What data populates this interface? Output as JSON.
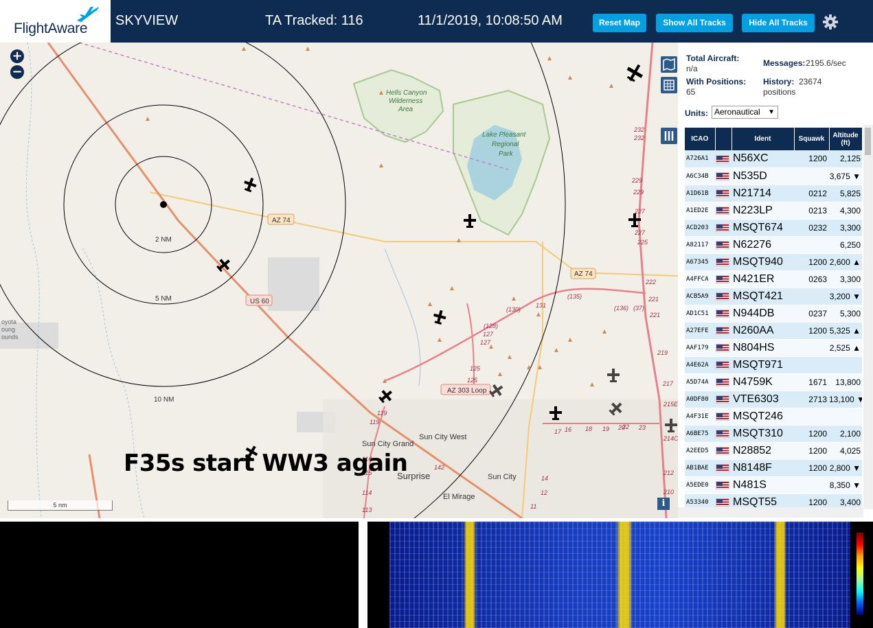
{
  "header": {
    "logo": "FlightAware",
    "app_name": "SKYVIEW",
    "tracked": "TA Tracked: 116",
    "datetime": "11/1/2019, 10:08:50 AM",
    "reset_map": "Reset Map",
    "show_all_tracks": "Show All Tracks",
    "hide_all_tracks": "Hide All Tracks"
  },
  "map": {
    "caption": "F35s start WW3 again",
    "scale": "5 nm",
    "zoom_in": "+",
    "zoom_out": "−",
    "info": "i",
    "rings": [
      "2 NM",
      "5 NM",
      "10 NM"
    ],
    "labels": {
      "hells_canyon": "Hells Canyon",
      "wilderness": "Wilderness",
      "area": "Area",
      "lake_pleasant": "Lake Pleasant",
      "regional": "Regional",
      "park": "Park",
      "az74_a": "AZ 74",
      "az74_b": "AZ 74",
      "us60": "US 60",
      "az303": "AZ 303 Loop",
      "sun_city_west": "Sun City West",
      "sun_city_grand": "Sun City Grand",
      "surprise": "Surprise",
      "sun_city": "Sun City",
      "el_mirage": "El Mirage",
      "coyote": "oyota",
      "coyote2": "oung",
      "coyote3": "ounds",
      "r131": "131",
      "r135": "(135)",
      "r130": "(130)",
      "r128": "(128)",
      "r127": "127",
      "r125": "125",
      "r136": "(136)",
      "r37": "(37)",
      "r119": "119",
      "r142": "142",
      "r17": "17",
      "r16": "16",
      "r18": "18",
      "r19": "19",
      "r20": "20",
      "r22": "22",
      "r23": "23",
      "r232": "232",
      "r229": "229",
      "r227": "227",
      "r225": "225",
      "r222": "222",
      "r221": "221",
      "r219": "219",
      "r217": "217",
      "r215": "215E",
      "r214": "214C",
      "r212": "212",
      "r210": "210",
      "r116": "116",
      "r115": "115",
      "r114": "114",
      "r113": "113",
      "r14": "14",
      "r12": "12",
      "r11": "11"
    }
  },
  "sidebar": {
    "total_aircraft_label": "Total Aircraft:",
    "total_aircraft_value": "n/a",
    "messages_label": "Messages:",
    "messages_value": "2195.6/sec",
    "with_positions_label": "With Positions:",
    "with_positions_value": "65",
    "history_label": "History:",
    "history_value": "23674",
    "history_unit": "positions",
    "units_label": "Units:",
    "units_value": "Aeronautical",
    "columns": [
      "ICAO",
      "",
      "Ident",
      "Squawk",
      "Altitude (ft)"
    ],
    "rows": [
      {
        "icao": "A726A1",
        "ident": "N56XC",
        "squawk": "1200",
        "alt": "2,125"
      },
      {
        "icao": "A6C34B",
        "ident": "N535D",
        "squawk": "",
        "alt": "3,675 ▼"
      },
      {
        "icao": "A1D61B",
        "ident": "N21714",
        "squawk": "0212",
        "alt": "5,825"
      },
      {
        "icao": "A1ED2E",
        "ident": "N223LP",
        "squawk": "0213",
        "alt": "4,300"
      },
      {
        "icao": "ACD203",
        "ident": "MSQT674",
        "squawk": "0232",
        "alt": "3,300"
      },
      {
        "icao": "A82117",
        "ident": "N62276",
        "squawk": "",
        "alt": "6,250"
      },
      {
        "icao": "A67345",
        "ident": "MSQT940",
        "squawk": "1200",
        "alt": "2,600 ▲"
      },
      {
        "icao": "A4FFCA",
        "ident": "N421ER",
        "squawk": "0263",
        "alt": "3,300"
      },
      {
        "icao": "ACB5A9",
        "ident": "MSQT421",
        "squawk": "",
        "alt": "3,200 ▼"
      },
      {
        "icao": "AD1C51",
        "ident": "N944DB",
        "squawk": "0237",
        "alt": "5,300"
      },
      {
        "icao": "A27EFE",
        "ident": "N260AA",
        "squawk": "1200",
        "alt": "5,325 ▲"
      },
      {
        "icao": "AAF179",
        "ident": "N804HS",
        "squawk": "",
        "alt": "2,525 ▲"
      },
      {
        "icao": "A4E62A",
        "ident": "MSQT971",
        "squawk": "",
        "alt": ""
      },
      {
        "icao": "A5D74A",
        "ident": "N4759K",
        "squawk": "1671",
        "alt": "13,800"
      },
      {
        "icao": "A0DF80",
        "ident": "VTE6303",
        "squawk": "2713",
        "alt": "13,100 ▼"
      },
      {
        "icao": "A4F31E",
        "ident": "MSQT246",
        "squawk": "",
        "alt": ""
      },
      {
        "icao": "A6BE75",
        "ident": "MSQT310",
        "squawk": "1200",
        "alt": "2,100"
      },
      {
        "icao": "A2EED5",
        "ident": "N28852",
        "squawk": "1200",
        "alt": "4,025"
      },
      {
        "icao": "AB1BAE",
        "ident": "N8148F",
        "squawk": "1200",
        "alt": "2,800 ▼"
      },
      {
        "icao": "A5EDE0",
        "ident": "N481S",
        "squawk": "",
        "alt": "8,350 ▼"
      },
      {
        "icao": "A53340",
        "ident": "MSQT55",
        "squawk": "1200",
        "alt": "3,400"
      }
    ]
  },
  "colors": {
    "header_bg": "#0e2b52",
    "button_bg": "#00a0e2",
    "row_odd": "#d9ecf7",
    "row_even": "#f3f9fd"
  }
}
